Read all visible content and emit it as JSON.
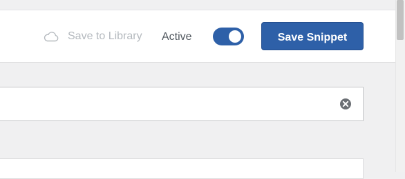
{
  "toolbar": {
    "save_to_library_label": "Save to Library",
    "active_label": "Active",
    "active_toggle_on": true,
    "save_button_label": "Save Snippet"
  },
  "snippet": {
    "title_value": "",
    "title_placeholder": ""
  },
  "icons": {
    "cloud": "cloud-icon",
    "clear": "clear-icon"
  },
  "colors": {
    "accent": "#2e60a8",
    "muted_text": "#b4b9be",
    "label_text": "#50575e",
    "page_background": "#f0f0f1"
  }
}
